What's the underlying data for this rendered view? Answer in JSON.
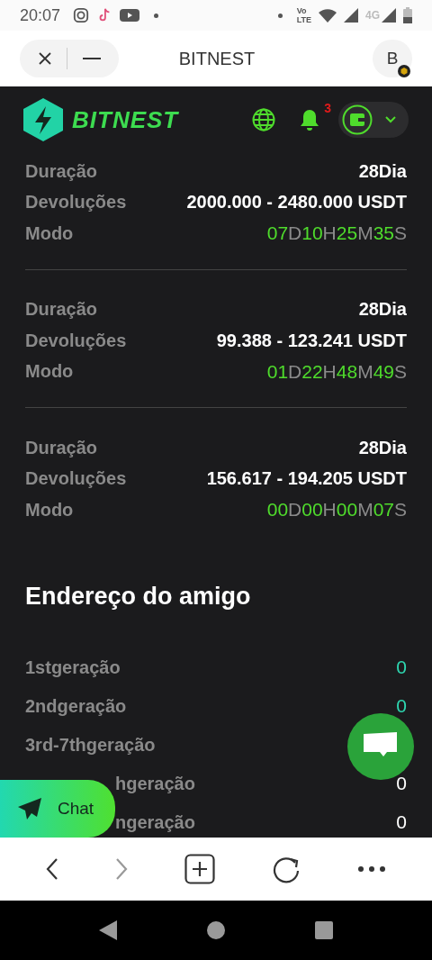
{
  "status_bar": {
    "time": "20:07",
    "network_top": "Vo",
    "network_bottom": "LTE",
    "second_network": "4G"
  },
  "browser": {
    "title": "BITNEST",
    "avatar": "B"
  },
  "site_header": {
    "logo": "BITNEST",
    "notifications": "3"
  },
  "orders": [
    {
      "duration_label": "Duração",
      "duration": "28Dia",
      "returns_label": "Devoluções",
      "returns": "2000.000 - 2480.000 USDT",
      "mode_label": "Modo",
      "timer": [
        {
          "value": "07",
          "unit": "D"
        },
        {
          "value": "10",
          "unit": "H"
        },
        {
          "value": "25",
          "unit": "M"
        },
        {
          "value": "35",
          "unit": "S"
        }
      ]
    },
    {
      "duration_label": "Duração",
      "duration": "28Dia",
      "returns_label": "Devoluções",
      "returns": "99.388 - 123.241 USDT",
      "mode_label": "Modo",
      "timer": [
        {
          "value": "01",
          "unit": "D"
        },
        {
          "value": "22",
          "unit": "H"
        },
        {
          "value": "48",
          "unit": "M"
        },
        {
          "value": "49",
          "unit": "S"
        }
      ]
    },
    {
      "duration_label": "Duração",
      "duration": "28Dia",
      "returns_label": "Devoluções",
      "returns": "156.617 - 194.205 USDT",
      "mode_label": "Modo",
      "timer": [
        {
          "value": "00",
          "unit": "D"
        },
        {
          "value": "00",
          "unit": "H"
        },
        {
          "value": "00",
          "unit": "M"
        },
        {
          "value": "07",
          "unit": "S"
        }
      ]
    }
  ],
  "friends": {
    "title": "Endereço do amigo",
    "rows": [
      {
        "label": "1stgeração",
        "value": "0",
        "color": "#2ed6b0",
        "covered": false
      },
      {
        "label": "2ndgeração",
        "value": "0",
        "color": "#2ed6b0",
        "covered": false
      },
      {
        "label": "3rd-7thgeração",
        "covered": false
      },
      {
        "label": "hgeração",
        "value": "0",
        "color": "#ffffff",
        "covered": true
      },
      {
        "label": "ngeração",
        "value": "0",
        "color": "#ffffff",
        "covered": true
      }
    ]
  },
  "chat_button": {
    "label": "Chat"
  }
}
